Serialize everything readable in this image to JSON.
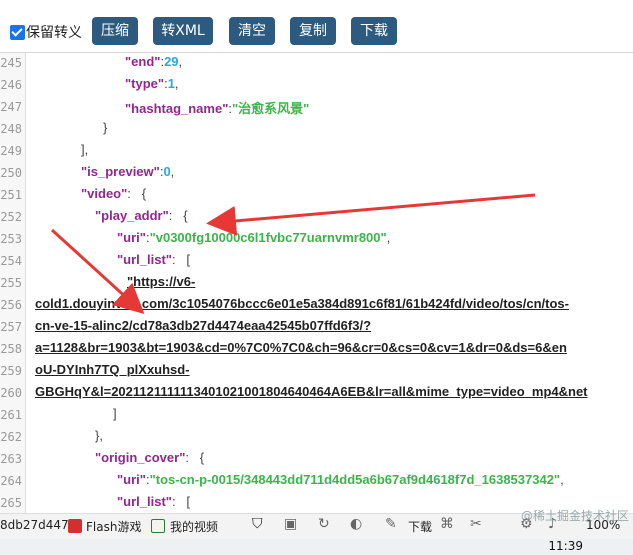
{
  "toolbar": {
    "keep_escape_label": "保留转义",
    "buttons": [
      "压缩",
      "转XML",
      "清空",
      "复制",
      "下载"
    ]
  },
  "editor": {
    "lines": [
      {
        "n": "245",
        "parts": [
          [
            "k",
            "\"end\""
          ],
          [
            "p",
            ":"
          ],
          [
            "n",
            "29"
          ],
          [
            "p",
            ","
          ]
        ],
        "indent": 90
      },
      {
        "n": "246",
        "parts": [
          [
            "k",
            "\"type\""
          ],
          [
            "p",
            ":"
          ],
          [
            "n",
            "1"
          ],
          [
            "p",
            ","
          ]
        ],
        "indent": 90
      },
      {
        "n": "247",
        "parts": [
          [
            "k",
            "\"hashtag_name\""
          ],
          [
            "p",
            ":"
          ],
          [
            "s",
            "\"治愈系风景\""
          ]
        ],
        "indent": 90
      },
      {
        "n": "248",
        "parts": [
          [
            "p",
            "}"
          ]
        ],
        "indent": 68
      },
      {
        "n": "249",
        "parts": [
          [
            "p",
            "],"
          ]
        ],
        "indent": 46
      },
      {
        "n": "250",
        "parts": [
          [
            "k",
            "\"is_preview\""
          ],
          [
            "p",
            ":"
          ],
          [
            "n",
            "0"
          ],
          [
            "p",
            ","
          ]
        ],
        "indent": 46
      },
      {
        "n": "251",
        "parts": [
          [
            "k",
            "\"video\""
          ],
          [
            "p",
            ":   {"
          ]
        ],
        "indent": 46
      },
      {
        "n": "252",
        "parts": [
          [
            "k",
            "\"play_addr\""
          ],
          [
            "p",
            ":   {"
          ]
        ],
        "indent": 60
      },
      {
        "n": "253",
        "parts": [
          [
            "k",
            "\"uri\""
          ],
          [
            "p",
            ":"
          ],
          [
            "s",
            "\"v0300fg10000c6l1fvbc77uarnvmr800\""
          ],
          [
            "p",
            ","
          ]
        ],
        "indent": 82
      },
      {
        "n": "254",
        "parts": [
          [
            "k",
            "\"url_list\""
          ],
          [
            "p",
            ":   ["
          ]
        ],
        "indent": 82
      },
      {
        "n": "255",
        "parts": [
          [
            "u",
            "\"https://v6-"
          ]
        ],
        "indent": 92
      },
      {
        "n": "256",
        "parts": [
          [
            "u",
            "cold1.douyinvod.com/3c1054076bccc6e01e5a384d891c6f81/61b424fd/video/tos/cn/tos-"
          ]
        ],
        "indent": 0
      },
      {
        "n": "257",
        "parts": [
          [
            "u",
            "cn-ve-15-alinc2/cd78a3db27d4474eaa42545b07ffd6f3/?"
          ]
        ],
        "indent": 0
      },
      {
        "n": "258",
        "parts": [
          [
            "u",
            "a=1128&br=1903&bt=1903&cd=0%7C0%7C0&ch=96&cr=0&cs=0&cv=1&dr=0&ds=6&en"
          ]
        ],
        "indent": 0
      },
      {
        "n": "259",
        "parts": [
          [
            "u",
            "oU-DYInh7TQ_plXxuhsd-"
          ]
        ],
        "indent": 0
      },
      {
        "n": "260",
        "parts": [
          [
            "u",
            "GBGHqY&l=2021121111113401021001804640464A6EB&lr=all&mime_type=video_mp4&net"
          ]
        ],
        "indent": 0
      },
      {
        "n": "261",
        "parts": [
          [
            "p",
            "]"
          ]
        ],
        "indent": 78
      },
      {
        "n": "262",
        "parts": [
          [
            "p",
            "},"
          ]
        ],
        "indent": 60
      },
      {
        "n": "263",
        "parts": [
          [
            "k",
            "\"origin_cover\""
          ],
          [
            "p",
            ":   {"
          ]
        ],
        "indent": 60
      },
      {
        "n": "264",
        "parts": [
          [
            "k",
            "\"uri\""
          ],
          [
            "p",
            ":"
          ],
          [
            "s",
            "\"tos-cn-p-0015/348443dd711d4dd5a6b67af9d4618f7d_1638537342\""
          ],
          [
            "p",
            ","
          ]
        ],
        "indent": 82
      },
      {
        "n": "265",
        "parts": [
          [
            "k",
            "\"url_list\""
          ],
          [
            "p",
            ":   ["
          ]
        ],
        "indent": 82
      }
    ]
  },
  "statusbar": {
    "left_text": "8db27d447",
    "flash_label": "Flash游戏",
    "video_label": "我的视频",
    "download_label": "下载",
    "zoom": "100%"
  },
  "clock": "11:39",
  "watermark": "@稀土掘金技术社区",
  "colors": {
    "button": "#2d5a7f",
    "key": "#92278f",
    "string": "#3ab54a",
    "number": "#25aae1",
    "arrow": "#e53935"
  }
}
